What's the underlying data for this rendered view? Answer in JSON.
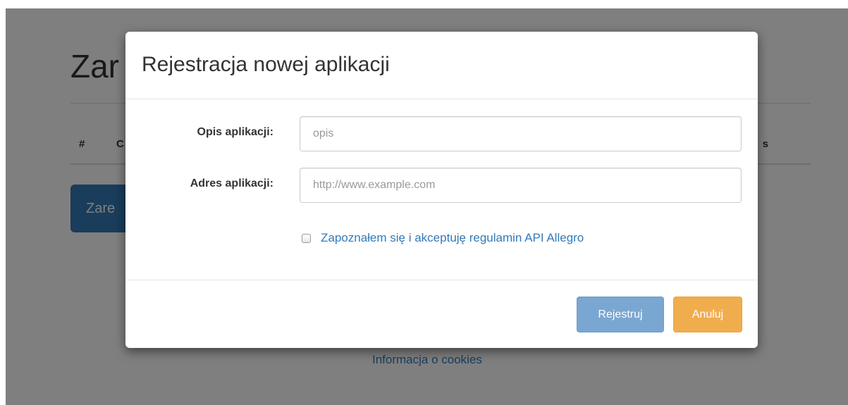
{
  "background": {
    "title": "Zar",
    "table_headers": {
      "hash": "#",
      "col2": "C",
      "col_last": "s"
    },
    "register_button_label": "Zare",
    "cookies_link": "Informacja o cookies"
  },
  "modal": {
    "title": "Rejestracja nowej aplikacji",
    "description": {
      "label": "Opis aplikacji:",
      "value": "",
      "placeholder": "opis"
    },
    "address": {
      "label": "Adres aplikacji:",
      "value": "",
      "placeholder": "http://www.example.com"
    },
    "terms_checkbox": {
      "checked": false,
      "label": "Zapoznałem się i akceptuję regulamin API Allegro"
    },
    "buttons": {
      "register_label": "Rejestruj",
      "cancel_label": "Anuluj"
    }
  },
  "colors": {
    "primary": "#337ab7",
    "primary_disabled": "#7aa6d2",
    "warning": "#f0ad4e"
  }
}
